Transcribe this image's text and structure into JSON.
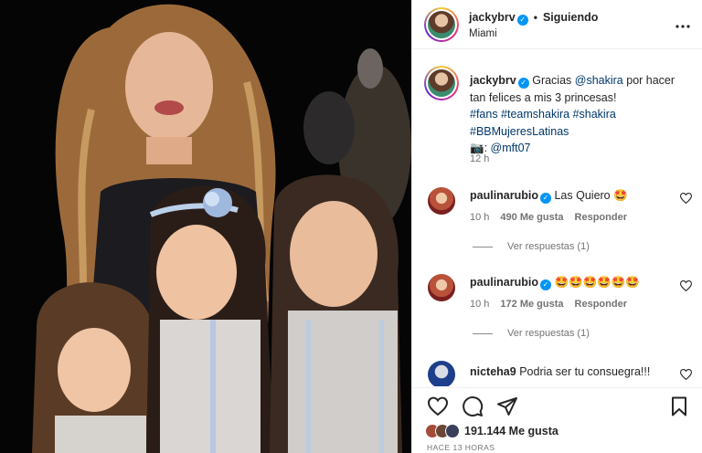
{
  "post": {
    "username": "jackybrv",
    "follow_status": "Siguiendo",
    "separator": "•",
    "location": "Miami",
    "more_icon": "more-options-icon",
    "verified_glyph": "✓"
  },
  "caption": {
    "username": "jackybrv",
    "t1": "Gracias ",
    "mention": "@shakira",
    "t2": " por hacer tan felices a mis 3 princesas!",
    "hashtags_line1": "#fans #teamshakira #shakira",
    "hashtags_line2": "#BBMujeresLatinas",
    "camera": "📷",
    "credit_sep": ": ",
    "credit": "@mft07",
    "time": "12 h"
  },
  "comments": [
    {
      "username": "paulinarubio",
      "text": "Las Quiero 🤩",
      "time": "10 h",
      "likes": "490 Me gusta",
      "reply": "Responder",
      "view_replies": "Ver respuestas (1)"
    },
    {
      "username": "paulinarubio",
      "text": "🤩🤩🤩🤩🤩🤩",
      "time": "10 h",
      "likes": "172 Me gusta",
      "reply": "Responder",
      "view_replies": "Ver respuestas (1)"
    },
    {
      "username": "nicteha9",
      "text": "Podria ser tu consuegra!!!"
    }
  ],
  "footer": {
    "likes": "191.144 Me gusta",
    "timestamp": "HACE 13 HORAS"
  },
  "colors": {
    "verified": "#0095f6",
    "link": "#00376b",
    "muted": "#737373"
  }
}
